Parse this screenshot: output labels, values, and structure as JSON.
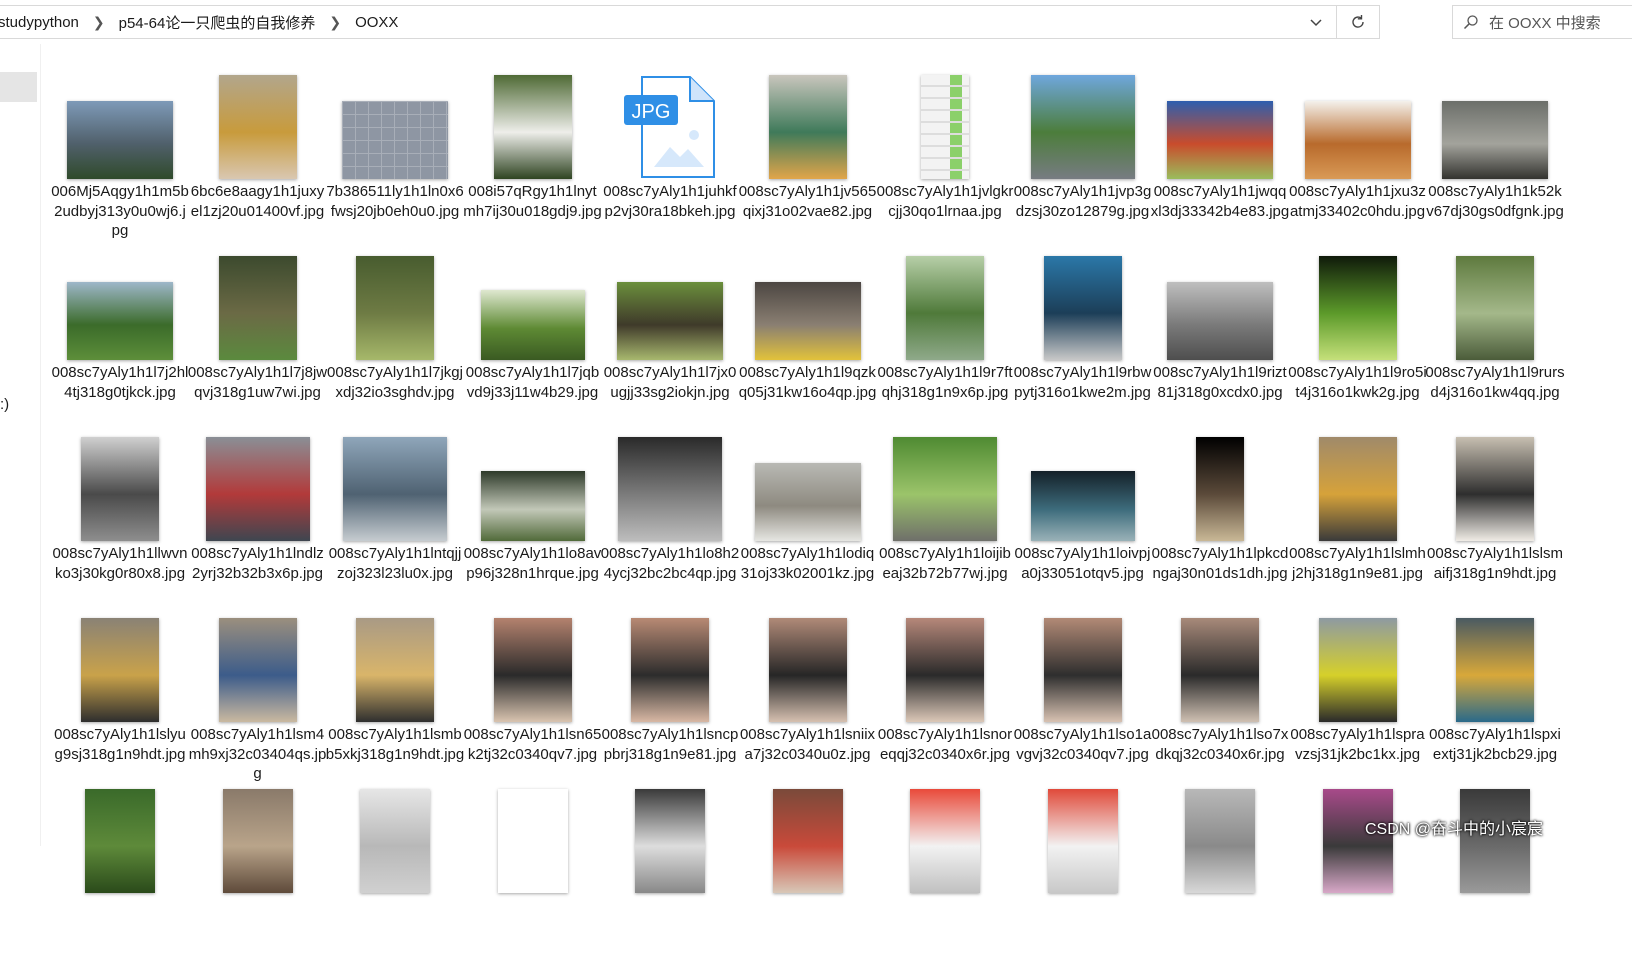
{
  "breadcrumbs": [
    "studypython",
    "p54-64论一只爬虫的自我修养",
    "OOXX"
  ],
  "search": {
    "placeholder": "在 OOXX 中搜索"
  },
  "left_pane": {
    "fragment": ":)"
  },
  "watermark": "CSDN @奋斗中的小宸宸",
  "files": [
    {
      "name": "006Mj5Aqgy1h1m5b2udbyj313y0u0wj6.jpg",
      "thumb": "landscape",
      "colors": [
        "#7e9ab8",
        "#50606b",
        "#2f4a2a"
      ]
    },
    {
      "name": "6bc6e8aagy1h1juxyel1zj20u01400vf.jpg",
      "thumb": "portrait",
      "colors": [
        "#b2a68c",
        "#c89b3c",
        "#d9c7b1"
      ]
    },
    {
      "name": "7b386511ly1h1ln0x6fwsj20jb0eh0u0.jpg",
      "thumb": "landscape",
      "colors": [
        "#8e96a3",
        "#6f7784",
        "#a8aeb8"
      ]
    },
    {
      "name": "008i57qRgy1h1lnytmh7ij30u018gdj9.jpg",
      "thumb": "portrait",
      "colors": [
        "#4f6a35",
        "#eeeeea",
        "#2f4422"
      ]
    },
    {
      "name": "008sc7yAly1h1juhkfp2vj30ra18bkeh.jpg",
      "thumb": "jpgicon",
      "colors": [
        "#1e88e5",
        "#ffffff",
        "#bbdefb"
      ]
    },
    {
      "name": "008sc7yAly1h1jv565qixj31o02vae82.jpg",
      "thumb": "portrait",
      "colors": [
        "#c9c6bd",
        "#3f7a5a",
        "#e1a54a"
      ]
    },
    {
      "name": "008sc7yAly1h1jvlgkrcjj30qo1lrnaa.jpg",
      "thumb": "phone",
      "colors": [
        "#f3f3f3",
        "#8bd06a",
        "#dddddd"
      ]
    },
    {
      "name": "008sc7yAly1h1jvp3gdzsj30zo12879g.jpg",
      "thumb": "square",
      "colors": [
        "#6fa7dd",
        "#4c7d3b",
        "#777c82"
      ]
    },
    {
      "name": "008sc7yAly1h1jwqqxl3dj33342b4e83.jpg",
      "thumb": "landscape",
      "colors": [
        "#2e5fae",
        "#c94c2c",
        "#9abd5c"
      ]
    },
    {
      "name": "008sc7yAly1h1jxu3zatmj33402c0hdu.jpg",
      "thumb": "landscape",
      "colors": [
        "#f4f1ec",
        "#b86a2c",
        "#d99a56"
      ]
    },
    {
      "name": "008sc7yAly1h1k52kv67dj30gs0dfgnk.jpg",
      "thumb": "landscape",
      "colors": [
        "#6c6f6a",
        "#a3a39c",
        "#33332f"
      ]
    },
    {
      "name": "008sc7yAly1h1l7j2hl4tj318g0tjkck.jpg",
      "thumb": "landscape",
      "colors": [
        "#9eb7c9",
        "#3b6b2a",
        "#5d8e3a"
      ]
    },
    {
      "name": "008sc7yAly1h1l7j8jwqvj318g1uw7wi.jpg",
      "thumb": "portrait",
      "colors": [
        "#3c4a2e",
        "#6b6a45",
        "#5b8a3e"
      ]
    },
    {
      "name": "008sc7yAly1h1l7jkgjxdj32io3sghdv.jpg",
      "thumb": "portrait",
      "colors": [
        "#485c2f",
        "#6e7b44",
        "#a6b86a"
      ]
    },
    {
      "name": "008sc7yAly1h1l7jqbvd9j33j11w4b29.jpg",
      "thumb": "wide",
      "colors": [
        "#dfe8d0",
        "#5e8a34",
        "#3a5a22"
      ]
    },
    {
      "name": "008sc7yAly1h1l7jx0ugjj33sg2iokjn.jpg",
      "thumb": "landscape",
      "colors": [
        "#6b8f3c",
        "#3f3a2a",
        "#a8b86e"
      ]
    },
    {
      "name": "008sc7yAly1h1l9qzkq05j31kw16o4qp.jpg",
      "thumb": "landscape",
      "colors": [
        "#4c4642",
        "#8a7f72",
        "#e2c23b"
      ]
    },
    {
      "name": "008sc7yAly1h1l9r7ftqhj318g1n9x6p.jpg",
      "thumb": "portrait",
      "colors": [
        "#b7cfa8",
        "#4f7a3a",
        "#8fa98a"
      ]
    },
    {
      "name": "008sc7yAly1h1l9rbwpytj316o1kwe2m.jpg",
      "thumb": "portrait",
      "colors": [
        "#2b78a8",
        "#1c3e58",
        "#c8c8c8"
      ]
    },
    {
      "name": "008sc7yAly1h1l9rizt81j318g0xcdx0.jpg",
      "thumb": "landscape",
      "colors": [
        "#bfbfbf",
        "#7a7a7a",
        "#4e4e4e"
      ]
    },
    {
      "name": "008sc7yAly1h1l9ro5it4j316o1kwk2g.jpg",
      "thumb": "portrait",
      "colors": [
        "#0f1a0a",
        "#5c9a2a",
        "#c5e07a"
      ]
    },
    {
      "name": "008sc7yAly1h1l9rursd4j316o1kw4qq.jpg",
      "thumb": "portrait",
      "colors": [
        "#5e7a3e",
        "#a4b88a",
        "#4b5c3a"
      ]
    },
    {
      "name": "008sc7yAly1h1llwvnko3j30kg0r80x8.jpg",
      "thumb": "portrait",
      "colors": [
        "#d0d0d0",
        "#4a4a4a",
        "#8e8e8e"
      ]
    },
    {
      "name": "008sc7yAly1h1lndlz2yrj32b32b3x6p.jpg",
      "thumb": "square",
      "colors": [
        "#8a8f96",
        "#b23a3a",
        "#3e4650"
      ]
    },
    {
      "name": "008sc7yAly1h1lntqjjzoj323l23lu0x.jpg",
      "thumb": "square",
      "colors": [
        "#8fa6ba",
        "#4f6272",
        "#c6ccd0"
      ]
    },
    {
      "name": "008sc7yAly1h1lo8avp96j328n1hrque.jpg",
      "thumb": "wide",
      "colors": [
        "#2e3a2a",
        "#c2c8b8",
        "#516a3a"
      ]
    },
    {
      "name": "008sc7yAly1h1lo8h24ycj32bc2bc4qp.jpg",
      "thumb": "square",
      "colors": [
        "#2a2a2a",
        "#7b7b7b",
        "#bdbdbd"
      ]
    },
    {
      "name": "008sc7yAly1h1lodiq31oj33k02001kz.jpg",
      "thumb": "landscape",
      "colors": [
        "#b9b9b4",
        "#8e8a80",
        "#e6e6e2"
      ]
    },
    {
      "name": "008sc7yAly1h1loijibeaj32b72b77wj.jpg",
      "thumb": "square",
      "colors": [
        "#4f8a32",
        "#9bc46a",
        "#6f6f6a"
      ]
    },
    {
      "name": "008sc7yAly1h1loivpja0j33051otqv5.jpg",
      "thumb": "wide",
      "colors": [
        "#142028",
        "#3d6c7c",
        "#9ab2b8"
      ]
    },
    {
      "name": "008sc7yAly1h1lpkcdngaj30n01ds1dh.jpg",
      "thumb": "tall",
      "colors": [
        "#000000",
        "#5b4a3a",
        "#c9b896"
      ]
    },
    {
      "name": "008sc7yAly1h1lslmhj2hj318g1n9e81.jpg",
      "thumb": "portrait",
      "colors": [
        "#a08a6a",
        "#d6a23a",
        "#3a3a3a"
      ]
    },
    {
      "name": "008sc7yAly1h1lslsmaifj318g1n9hdt.jpg",
      "thumb": "portrait",
      "colors": [
        "#c7bfb1",
        "#2e2e2e",
        "#f0ece6"
      ]
    },
    {
      "name": "008sc7yAly1h1lslyug9sj318g1n9hdt.jpg",
      "thumb": "portrait",
      "colors": [
        "#8a8275",
        "#c9a24a",
        "#2e2e2e"
      ]
    },
    {
      "name": "008sc7yAly1h1lsm4mh9xj32c03404qs.jpg",
      "thumb": "portrait",
      "colors": [
        "#9b8f7e",
        "#3c5c8a",
        "#cab9a0"
      ]
    },
    {
      "name": "008sc7yAly1h1lsmbb5xkj318g1n9hdt.jpg",
      "thumb": "portrait",
      "colors": [
        "#a99a85",
        "#d9b56a",
        "#2f2f2f"
      ]
    },
    {
      "name": "008sc7yAly1h1lsn65k2tj32c0340qv7.jpg",
      "thumb": "portrait",
      "colors": [
        "#b4826e",
        "#2a2a2a",
        "#d9c4b0"
      ]
    },
    {
      "name": "008sc7yAly1h1lsncppbrj318g1n9e81.jpg",
      "thumb": "portrait",
      "colors": [
        "#b88a74",
        "#2c2c2c",
        "#d8b8a4"
      ]
    },
    {
      "name": "008sc7yAly1h1lsniixa7j32c0340u0z.jpg",
      "thumb": "portrait",
      "colors": [
        "#b08a78",
        "#262626",
        "#d6c0b0"
      ]
    },
    {
      "name": "008sc7yAly1h1lsnoreqqj32c0340x6r.jpg",
      "thumb": "portrait",
      "colors": [
        "#b6887a",
        "#2a2a2a",
        "#dcc8b8"
      ]
    },
    {
      "name": "008sc7yAly1h1lso1avgvj32c0340qv7.jpg",
      "thumb": "portrait",
      "colors": [
        "#b28a76",
        "#2e2e2e",
        "#d8c2b2"
      ]
    },
    {
      "name": "008sc7yAly1h1lso7xdkqj32c0340x6r.jpg",
      "thumb": "portrait",
      "colors": [
        "#a88a7a",
        "#2a2a2a",
        "#cfc0b2"
      ]
    },
    {
      "name": "008sc7yAly1h1lspravzsj31jk2bc1kx.jpg",
      "thumb": "portrait",
      "colors": [
        "#8e9aa2",
        "#d6d02a",
        "#2a2a2a"
      ]
    },
    {
      "name": "008sc7yAly1h1lspxiextj31jk2bcb29.jpg",
      "thumb": "portrait",
      "colors": [
        "#4a5a62",
        "#d8a83a",
        "#2a6a8a"
      ]
    },
    {
      "name": "",
      "thumb": "partial",
      "colors": [
        "#3a6a2a",
        "#5e8a3a",
        "#2a4a1a"
      ]
    },
    {
      "name": "",
      "thumb": "partial",
      "colors": [
        "#8a7a6a",
        "#b9a48a",
        "#5e4a3a"
      ]
    },
    {
      "name": "",
      "thumb": "partial",
      "colors": [
        "#e6e6e6",
        "#b8b8b8",
        "#d0d0d0"
      ]
    },
    {
      "name": "",
      "thumb": "partial",
      "colors": [
        "#ffffff",
        "#ffffff",
        "#ffffff"
      ]
    },
    {
      "name": "",
      "thumb": "partial",
      "colors": [
        "#3a3a3a",
        "#dddddd",
        "#888888"
      ]
    },
    {
      "name": "",
      "thumb": "partial",
      "colors": [
        "#7a4a3a",
        "#c94a3a",
        "#d8c8b8"
      ]
    },
    {
      "name": "",
      "thumb": "partial",
      "colors": [
        "#e94a3a",
        "#f2f2f2",
        "#c0c0c0"
      ]
    },
    {
      "name": "",
      "thumb": "partial",
      "colors": [
        "#e04a3a",
        "#f2f2f2",
        "#c8c8c8"
      ]
    },
    {
      "name": "",
      "thumb": "partial",
      "colors": [
        "#b8b8b8",
        "#8a8a8a",
        "#d8d8d8"
      ]
    },
    {
      "name": "",
      "thumb": "partial",
      "colors": [
        "#a84a8a",
        "#3a3a3a",
        "#d8a8c8"
      ]
    },
    {
      "name": "",
      "thumb": "partial",
      "colors": [
        "#3a3a3a",
        "#6a6a6a",
        "#9a9a9a"
      ]
    }
  ]
}
